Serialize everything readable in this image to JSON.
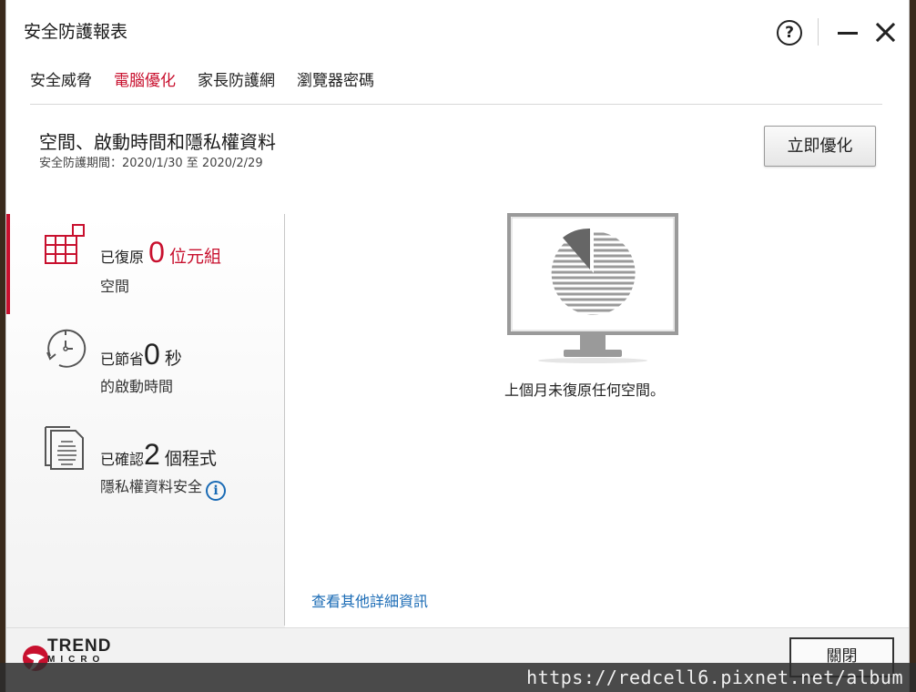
{
  "window": {
    "title": "安全防護報表",
    "help_label": "?"
  },
  "tabs": [
    {
      "label": "安全威脅",
      "active": false
    },
    {
      "label": "電腦優化",
      "active": true
    },
    {
      "label": "家長防護網",
      "active": false
    },
    {
      "label": "瀏覽器密碼",
      "active": false
    }
  ],
  "header": {
    "heading": "空間、啟動時間和隱私權資料",
    "period_label": "安全防護期間：",
    "period_value": "2020/1/30 至 2020/2/29",
    "optimize_button": "立即優化"
  },
  "stats": {
    "space": {
      "prefix": "已復原",
      "value": "0",
      "unit": "位元組",
      "line2": "空間",
      "icon": "disk-grid-icon"
    },
    "startup": {
      "prefix": "已節省",
      "value": "0",
      "unit": "秒",
      "line2": "的啟動時間",
      "icon": "stopwatch-icon"
    },
    "privacy": {
      "prefix": "已確認",
      "value": "2",
      "unit": "個程式",
      "line2": "隱私權資料安全",
      "icon": "document-icon"
    }
  },
  "main": {
    "empty_message": "上個月未復原任何空間。",
    "details_link": "查看其他詳細資訊"
  },
  "footer": {
    "logo_line1": "TREND",
    "logo_line2": "MICRO",
    "close_button": "關閉"
  },
  "watermark": "https://redcell6.pixnet.net/album",
  "colors": {
    "accent_red": "#c8102e",
    "link_blue": "#1a6bb5"
  }
}
